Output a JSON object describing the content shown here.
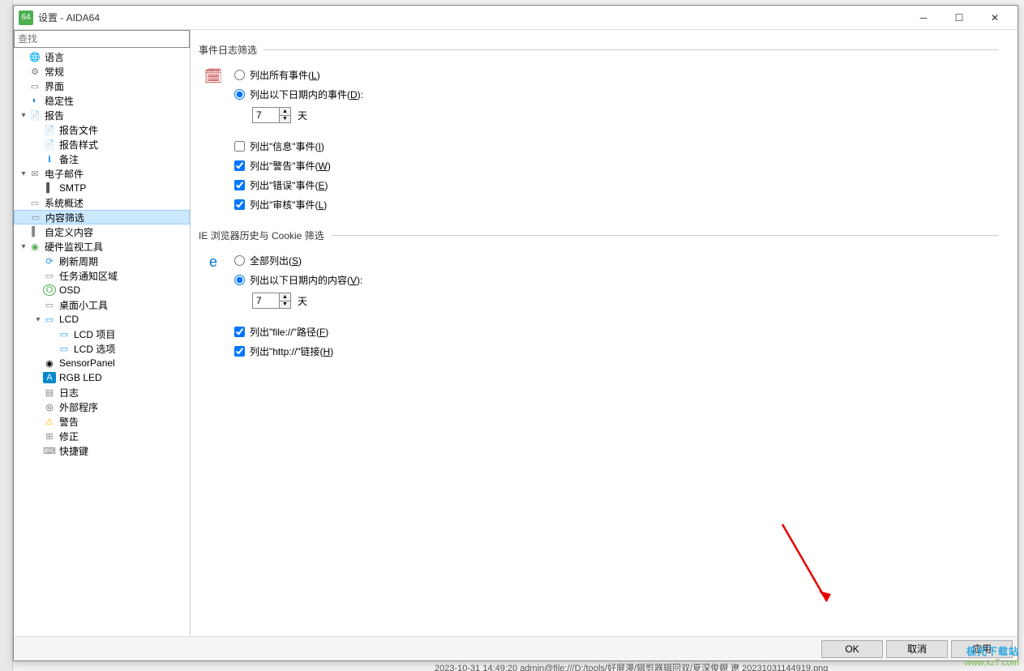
{
  "window": {
    "app_icon": "64",
    "title": "设置 - AIDA64"
  },
  "search": {
    "placeholder": "查找"
  },
  "tree": [
    {
      "label": "语言",
      "icon": "🌐",
      "cls": "ic-globe"
    },
    {
      "label": "常规",
      "icon": "⚙",
      "cls": "ic-gear"
    },
    {
      "label": "界面",
      "icon": "▭",
      "cls": "ic-ui"
    },
    {
      "label": "稳定性",
      "icon": "◐",
      "cls": "ic-stab"
    },
    {
      "label": "报告",
      "icon": "📄",
      "cls": "ic-rep",
      "children": [
        {
          "label": "报告文件",
          "icon": "📄",
          "cls": "ic-file"
        },
        {
          "label": "报告样式",
          "icon": "📄",
          "cls": "ic-file"
        },
        {
          "label": "备注",
          "icon": "ℹ",
          "cls": "ic-info"
        }
      ]
    },
    {
      "label": "电子邮件",
      "icon": "✉",
      "cls": "ic-mail",
      "children": [
        {
          "label": "SMTP",
          "icon": "▌",
          "cls": "ic-smtp"
        }
      ]
    },
    {
      "label": "系统概述",
      "icon": "▭",
      "cls": "ic-sys"
    },
    {
      "label": "内容筛选",
      "icon": "▭",
      "cls": "ic-filter",
      "selected": true
    },
    {
      "label": "自定义内容",
      "icon": "▌",
      "cls": "ic-cust"
    },
    {
      "label": "硬件监视工具",
      "icon": "◉",
      "cls": "ic-hw",
      "children": [
        {
          "label": "刷新周期",
          "icon": "⟳",
          "cls": "ic-refresh"
        },
        {
          "label": "任务通知区域",
          "icon": "▭",
          "cls": "ic-notif"
        },
        {
          "label": "OSD",
          "icon": "O",
          "cls": "ic-osd"
        },
        {
          "label": "桌面小工具",
          "icon": "▭",
          "cls": "ic-desk"
        },
        {
          "label": "LCD",
          "icon": "▭",
          "cls": "ic-lcd",
          "children": [
            {
              "label": "LCD 项目",
              "icon": "▭",
              "cls": "ic-lcd"
            },
            {
              "label": "LCD 选项",
              "icon": "▭",
              "cls": "ic-lcd"
            }
          ]
        },
        {
          "label": "SensorPanel",
          "icon": "◉",
          "cls": "ic-pan"
        },
        {
          "label": "RGB LED",
          "icon": "A",
          "cls": "ic-rgb"
        },
        {
          "label": "日志",
          "icon": "▤",
          "cls": "ic-log"
        },
        {
          "label": "外部程序",
          "icon": "◎",
          "cls": "ic-ext"
        },
        {
          "label": "警告",
          "icon": "⚠",
          "cls": "ic-warn"
        },
        {
          "label": "修正",
          "icon": "⊞",
          "cls": "ic-fix"
        },
        {
          "label": "快捷键",
          "icon": "⌨",
          "cls": "ic-key"
        }
      ]
    }
  ],
  "section1": {
    "title": "事件日志筛选",
    "radio_all": "列出所有事件(",
    "radio_all_u": "L",
    "radio_all_end": ")",
    "radio_days_pre": "列出以下日期内的事件(",
    "radio_days_u": "D",
    "radio_days_end": "):",
    "days_value": "7",
    "days_unit": "天",
    "chk_info_pre": "列出\"信息\"事件(",
    "chk_info_u": "I",
    "chk_info_end": ")",
    "chk_warn_pre": "列出\"警告\"事件(",
    "chk_warn_u": "W",
    "chk_warn_end": ")",
    "chk_err_pre": "列出\"错误\"事件(",
    "chk_err_u": "E",
    "chk_err_end": ")",
    "chk_audit_pre": "列出\"审核\"事件(",
    "chk_audit_u": "L",
    "chk_audit_end": ")"
  },
  "section2": {
    "title": "IE 浏览器历史与 Cookie 筛选",
    "radio_all": "全部列出(",
    "radio_all_u": "S",
    "radio_all_end": ")",
    "radio_days_pre": "列出以下日期内的内容(",
    "radio_days_u": "V",
    "radio_days_end": "):",
    "days_value": "7",
    "days_unit": "天",
    "chk_file_pre": "列出\"file://\"路径(",
    "chk_file_u": "F",
    "chk_file_end": ")",
    "chk_http_pre": "列出\"http://\"链接(",
    "chk_http_u": "H",
    "chk_http_end": ")"
  },
  "buttons": {
    "ok": "OK",
    "cancel": "取消",
    "apply": "应用"
  },
  "watermark": {
    "top": "极光下载站",
    "bot": "www.xz7.com"
  },
  "statusbar": "2023-10-31 14:49:20   admin@file:///D:/tools/好屏漫/辑剪器辑回双/夏深俊鋧   遼  20231031144919.png"
}
